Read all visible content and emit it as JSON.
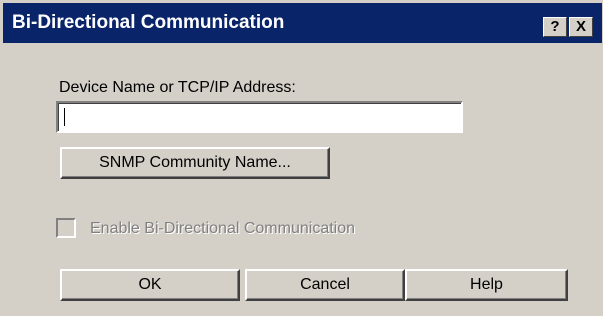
{
  "dialog": {
    "title": "Bi-Directional Communication",
    "titlebar_buttons": {
      "help": "?",
      "close": "X"
    },
    "device_field": {
      "label": "Device Name or TCP/IP Address:",
      "value": ""
    },
    "snmp_button": "SNMP Community Name...",
    "enable_checkbox": {
      "label": "Enable Bi-Directional Communication",
      "checked": false,
      "disabled": true
    },
    "buttons": {
      "ok": "OK",
      "cancel": "Cancel",
      "help": "Help"
    }
  },
  "colors": {
    "titlebar": "#0a246a",
    "face": "#d4d0c8",
    "disabled_text": "#808080"
  }
}
